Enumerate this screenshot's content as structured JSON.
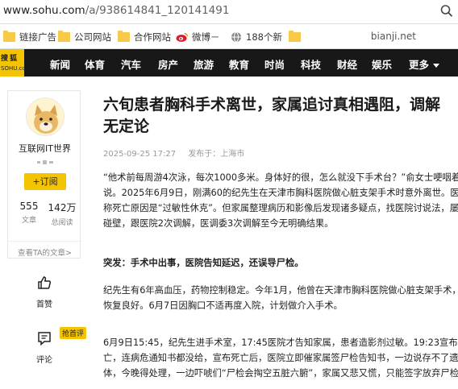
{
  "browser": {
    "url_host": "www.sohu.com",
    "url_path": "/a/938614841_120141491",
    "zoom_icon": "zoom-icon"
  },
  "bookmarks": {
    "items": [
      {
        "label": "链接广告",
        "icon": "folder-icon"
      },
      {
        "label": "公司网站",
        "icon": "folder-icon"
      },
      {
        "label": "合作网站",
        "icon": "folder-icon"
      },
      {
        "label": "微博－",
        "icon": "weibo-icon"
      },
      {
        "label": "188个新",
        "icon": "globe-icon"
      },
      {
        "label": "",
        "icon": "folder-icon"
      }
    ],
    "right_text": "bianji.net"
  },
  "nav": {
    "logo_top": "搜狐",
    "logo_bottom": "SOHU.com",
    "items": [
      "新闻",
      "体育",
      "汽车",
      "房产",
      "旅游",
      "教育",
      "时尚",
      "科技",
      "财经",
      "娱乐",
      "更多"
    ],
    "colors": {
      "bg": "#181818",
      "accent": "#f5c400"
    }
  },
  "author": {
    "name": "互联网IT世界",
    "follow_label": "+订阅",
    "articles_count": "555",
    "articles_label": "文章",
    "views_count": "142万",
    "views_label": "总阅读",
    "more_link": "查看TA的文章>"
  },
  "actions": {
    "like_label": "首赞",
    "comment_label": "评论",
    "comment_badge": "抢首评"
  },
  "article": {
    "title_line1": "六旬患者胸科手术离世，家属追讨真相遇阻，调解",
    "title_line2": "无定论",
    "date": "2025-09-25 17:27",
    "location": "发布于：上海市",
    "p1": [
      "“他术前每周游4次泳，每次1000多米。身体好的很，怎么就没下手术台？”俞女士哽咽着",
      "说。2025年6月9日，刚满60的纪先生在天津市胸科医院做心脏支架手术时意外离世。医院",
      "称死亡原因是“过敏性休克”。但家属整理病历和影像后发现诸多疑点，找医院讨说法，屡屡",
      "碰壁，跟医院2次调解，医调委3次调解至今无明确结果。"
    ],
    "subhead": "突发：手术中出事，医院告知延迟，还误导尸检。",
    "p2": [
      "纪先生有6年高血压，药物控制稳定。今年1月，他曾在天津市胸科医院做心脏支架手术，",
      "恢复良好。6月7日因胸口不适再度入院，计划做介入手术。"
    ],
    "p3": [
      "6月9日15:45，纪先生进手术室，17:45医院才告知家属，患者造影剂过敏。19:23宣布死",
      "亡，连病危通知书都没给，宣布死亡后，医院立即催家属签尸检告知书，一边说存不了遗",
      "体，今晚得处理，一边吓唬们“尸检会掏空五脏六腑”，家属又悲又慌，只能签字放弃尸检。"
    ]
  }
}
